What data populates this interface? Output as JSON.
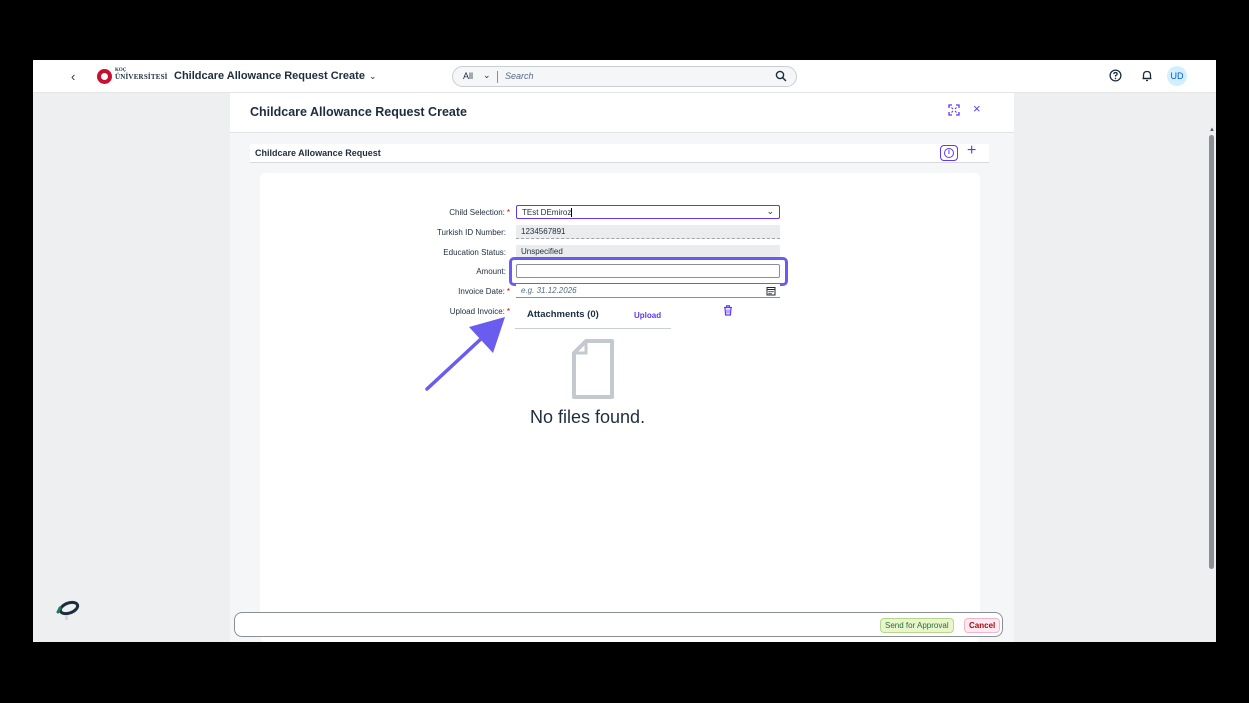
{
  "shell": {
    "back_glyph": "‹",
    "logo_line1": "KOÇ",
    "logo_line2": "ÜNİVERSİTESİ",
    "app_title": "Childcare Allowance Request Create",
    "app_title_chevron": "⌄",
    "search_scope": "All",
    "search_placeholder": "Search",
    "avatar_initials": "UD",
    "icons": [
      "back-icon",
      "search-icon",
      "help-icon",
      "bell-icon"
    ]
  },
  "dialog": {
    "title": "Childcare Allowance Request Create",
    "close_glyph": "×",
    "section_title": "Childcare Allowance Request",
    "info_glyph": "i",
    "plus_glyph": "+"
  },
  "form": {
    "child_label": "Child Selection:",
    "child_value": "TEst DEmiroz",
    "tid_label": "Turkish ID Number:",
    "tid_value": "1234567891",
    "edu_label": "Education Status:",
    "edu_value": "Unspecified",
    "amount_label": "Amount:",
    "amount_value": "",
    "invoice_label": "Invoice Date:",
    "invoice_placeholder": "e.g. 31.12.2026",
    "upload_label": "Upload Invoice:",
    "required_mark": "*"
  },
  "attachments": {
    "title": "Attachments (0)",
    "upload": "Upload",
    "empty_text": "No files found."
  },
  "footer": {
    "send": "Send for Approval",
    "cancel": "Cancel"
  },
  "colors": {
    "accent": "#5d36ff",
    "highlight": "#6b5cf0",
    "positive_bg": "#ebf5cb",
    "negative_bg": "#ffeaf4"
  }
}
